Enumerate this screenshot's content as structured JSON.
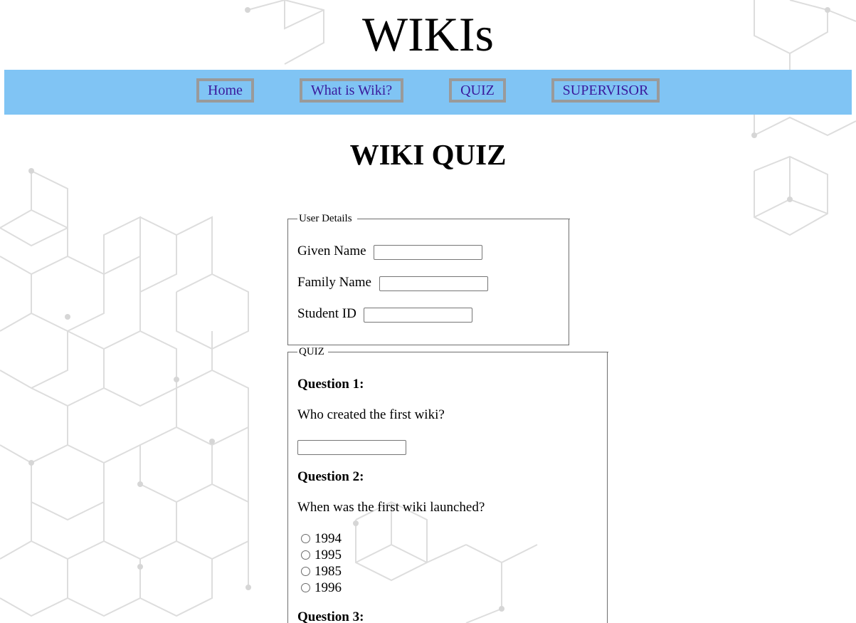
{
  "site": {
    "title": "WIKIs"
  },
  "nav": {
    "items": [
      {
        "label": "Home"
      },
      {
        "label": "What is Wiki?"
      },
      {
        "label": "QUIZ"
      },
      {
        "label": "SUPERVISOR"
      }
    ]
  },
  "page": {
    "heading": "WIKI QUIZ"
  },
  "user_details": {
    "legend": "User Details",
    "given_name_label": "Given Name",
    "given_name_value": "",
    "family_name_label": "Family Name",
    "family_name_value": "",
    "student_id_label": "Student ID",
    "student_id_value": ""
  },
  "quiz": {
    "legend": "QUIZ",
    "questions": [
      {
        "title": "Question 1:",
        "text": "Who created the first wiki?",
        "answer_value": ""
      },
      {
        "title": "Question 2:",
        "text": "When was the first wiki launched?",
        "options": [
          "1994",
          "1995",
          "1985",
          "1996"
        ]
      },
      {
        "title": "Question 3:"
      }
    ]
  },
  "colors": {
    "nav_background": "#80c4f4",
    "nav_link": "#3a1a9c",
    "nav_border": "#9a9a9a"
  }
}
